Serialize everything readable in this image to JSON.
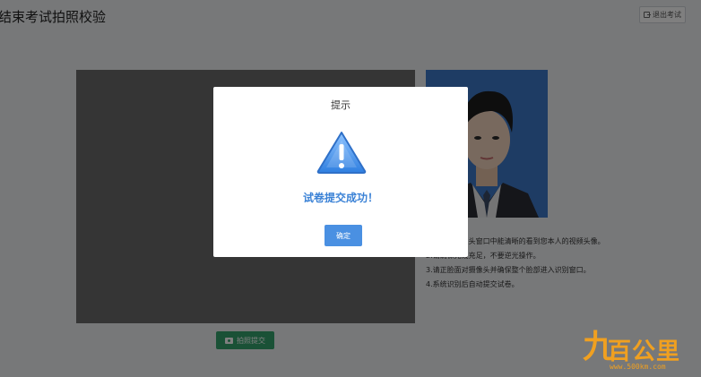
{
  "header": {
    "title": "结束考试拍照校验",
    "exit_label": "退出考试"
  },
  "instructions": [
    "1.请确保摄像头窗口中能清晰的看到您本人的视频头像。",
    "2.请确保光线充足，不要逆光操作。",
    "3.请正脸面对摄像头并确保整个脸部进入识别窗口。",
    "4.系统识别后自动提交试卷。"
  ],
  "capture": {
    "label": "拍照提交"
  },
  "dialog": {
    "title": "提示",
    "message": "试卷提交成功！",
    "ok_label": "确定",
    "icon": "warning-icon"
  },
  "watermark": {
    "glyph": "九",
    "text": "百公里",
    "url": "www.500km.com"
  },
  "colors": {
    "primary": "#4a90e2",
    "success": "#34a26d",
    "message": "#3b82d6",
    "watermark": "#f0a020"
  }
}
